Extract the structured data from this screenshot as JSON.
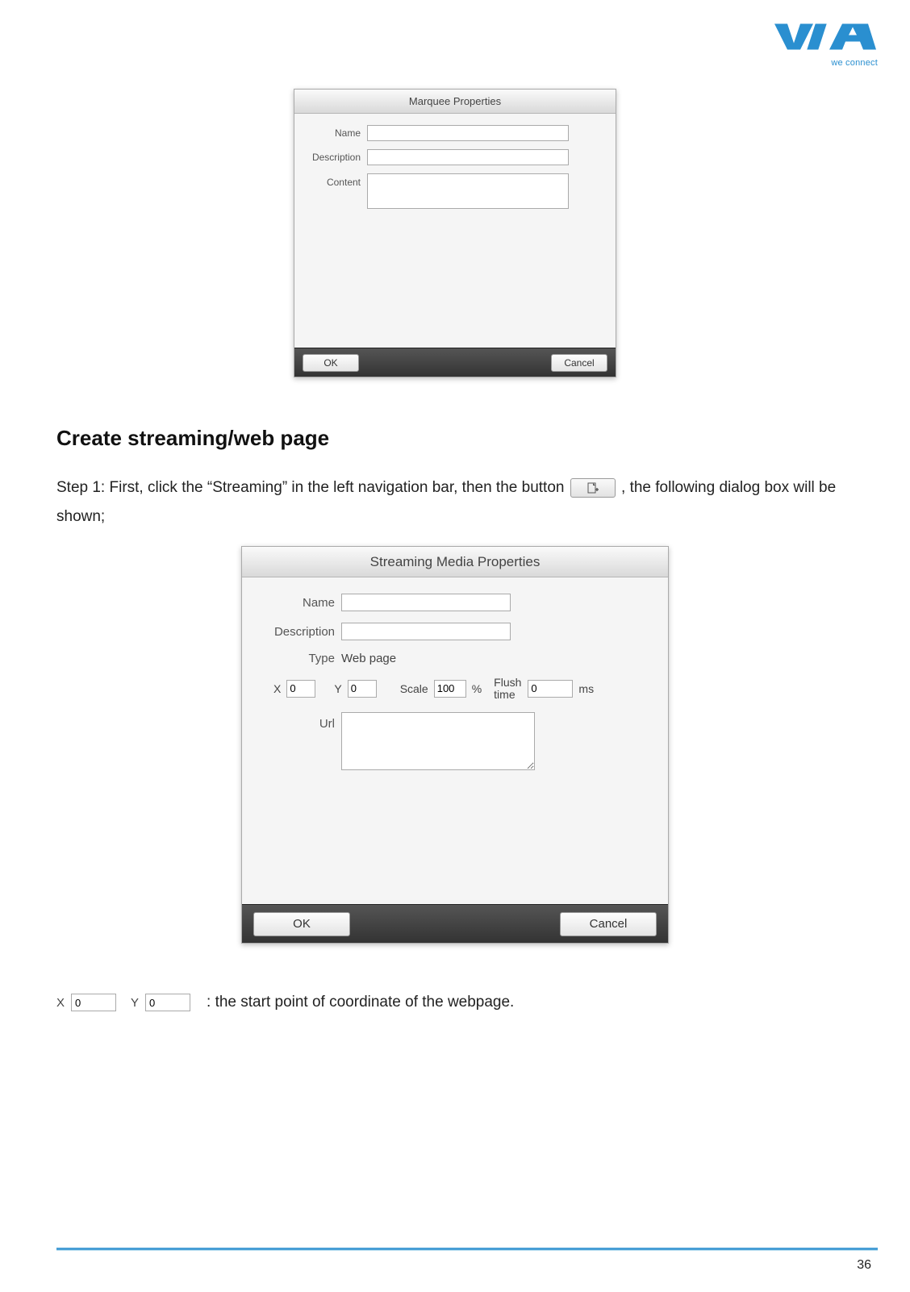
{
  "logo": {
    "tagline": "we connect"
  },
  "dialog1": {
    "title": "Marquee Properties",
    "labels": {
      "name": "Name",
      "description": "Description",
      "content": "Content"
    },
    "buttons": {
      "ok": "OK",
      "cancel": "Cancel"
    }
  },
  "section": {
    "heading": "Create streaming/web page",
    "step1_pre": "Step 1: First, click the “Streaming” in the left navigation bar, then the button",
    "step1_post": ", the following dialog box will be shown;"
  },
  "dialog2": {
    "title": "Streaming Media Properties",
    "labels": {
      "name": "Name",
      "description": "Description",
      "type": "Type",
      "url": "Url"
    },
    "type_value": "Web page",
    "coords": {
      "x_label": "X",
      "x_value": "0",
      "y_label": "Y",
      "y_value": "0",
      "scale_label": "Scale",
      "scale_value": "100",
      "percent": "%",
      "flush_label": "Flush time",
      "flush_value": "0",
      "ms": "ms"
    },
    "buttons": {
      "ok": "OK",
      "cancel": "Cancel"
    }
  },
  "legend": {
    "x_label": "X",
    "x_value": "0",
    "y_label": "Y",
    "y_value": "0",
    "text": ": the start point of coordinate of the webpage."
  },
  "page_number": "36"
}
